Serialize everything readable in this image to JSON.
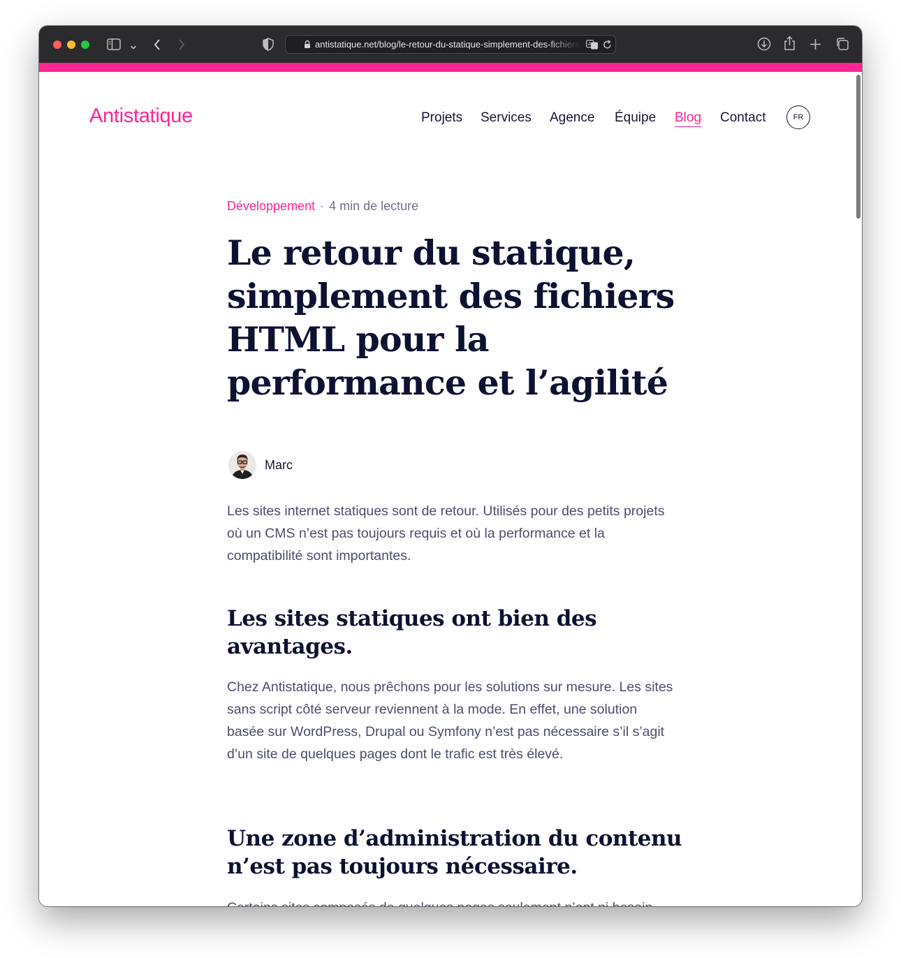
{
  "browser": {
    "url": "antistatique.net/blog/le-retour-du-statique-simplement-des-fichiers-html-pour-la-performance-et-lagilite"
  },
  "site": {
    "logo": "Antistatique",
    "nav": [
      "Projets",
      "Services",
      "Agence",
      "Équipe",
      "Blog",
      "Contact"
    ],
    "active_nav": "Blog",
    "lang": "FR"
  },
  "article": {
    "category": "Développement",
    "separator": "·",
    "reading_time": "4 min de lecture",
    "title": "Le retour du statique, simplement des fichiers HTML pour la performance et l’agilité",
    "author": "Marc",
    "intro": "Les sites internet statiques sont de retour. Utilisés pour des petits projets où un CMS n’est pas toujours requis et où la performance et la compatibilité sont importantes.",
    "sections": [
      {
        "heading": "Les sites statiques ont bien des avantages.",
        "body": "Chez Antistatique, nous prêchons pour les solutions sur mesure. Les sites sans script côté serveur reviennent à la mode. En effet, une solution basée sur WordPress, Drupal ou Symfony n’est pas nécessaire s’il s’agit d’un site de quelques pages dont le trafic est très élevé."
      },
      {
        "heading": "Une zone d’administration du contenu n’est pas toujours nécessaire.",
        "body": "Certains sites composés de quelques pages seulement n’ont ni besoin d’un CMS (Système de gestion de contenu) ni de logique"
      }
    ]
  },
  "colors": {
    "brand_pink": "#ff2595",
    "heading_navy": "#0d1132",
    "body_gray": "#4b4f6b"
  }
}
